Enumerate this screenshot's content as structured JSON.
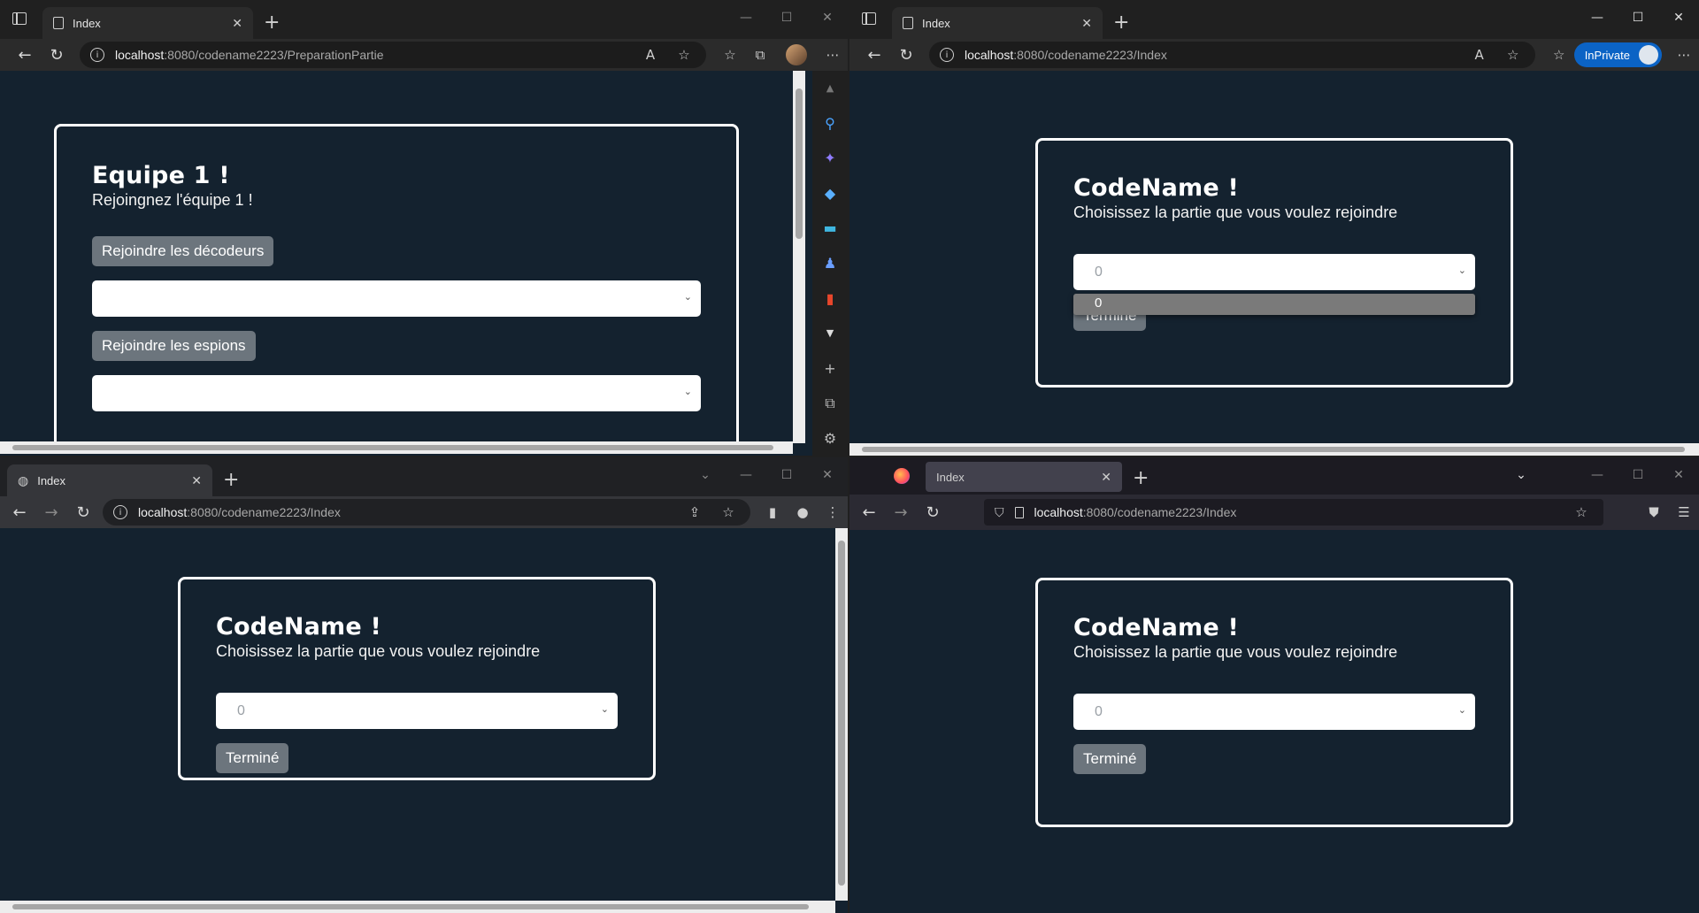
{
  "windows": {
    "w1": {
      "tab_title": "Index",
      "url_host": "localhost",
      "url_path": ":8080/codename2223/PreparationPartie",
      "card": {
        "title": "Equipe 1 !",
        "subtitle": "Rejoingnez l'équipe 1 !",
        "btn_decodeurs": "Rejoindre les décodeurs",
        "btn_espions": "Rejoindre les espions",
        "select1_value": "",
        "select2_value": ""
      }
    },
    "w2": {
      "tab_title": "Index",
      "url_host": "localhost",
      "url_path": ":8080/codename2223/Index",
      "inprivate_label": "InPrivate",
      "card": {
        "title": "CodeName !",
        "subtitle": "Choisissez la partie que vous voulez rejoindre",
        "select_value": "0",
        "dropdown_option": "0",
        "done_button": "Terminé"
      }
    },
    "w3": {
      "tab_title": "Index",
      "url_host": "localhost",
      "url_path": ":8080/codename2223/Index",
      "card": {
        "title": "CodeName !",
        "subtitle": "Choisissez la partie que vous voulez rejoindre",
        "select_value": "0",
        "done_button": "Terminé"
      }
    },
    "w4": {
      "tab_title": "Index",
      "url_host": "localhost",
      "url_path": ":8080/codename2223/Index",
      "card": {
        "title": "CodeName !",
        "subtitle": "Choisissez la partie que vous voulez rejoindre",
        "select_value": "0",
        "done_button": "Terminé"
      }
    }
  },
  "colors": {
    "page_bg": "#14222f",
    "button_bg": "#6c757d",
    "inprivate": "#0b63c5"
  }
}
